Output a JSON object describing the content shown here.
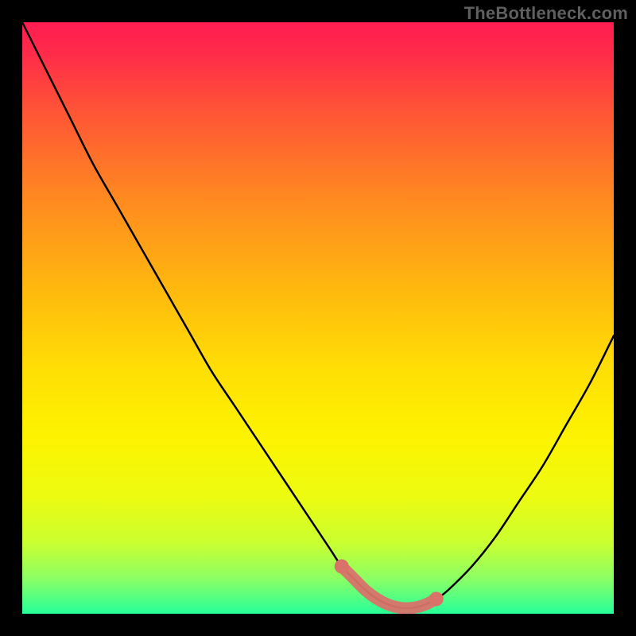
{
  "watermark": "TheBottleneck.com",
  "chart_data": {
    "type": "line",
    "title": "",
    "xlabel": "",
    "ylabel": "",
    "xlim": [
      0,
      100
    ],
    "ylim": [
      0,
      100
    ],
    "grid": false,
    "legend": false,
    "series": [
      {
        "name": "curve",
        "color": "#000000",
        "x": [
          0,
          4,
          8,
          12,
          16,
          20,
          24,
          28,
          32,
          36,
          40,
          44,
          48,
          52,
          54,
          56,
          58,
          60,
          62,
          64,
          66,
          68,
          70,
          72,
          76,
          80,
          84,
          88,
          92,
          96,
          100
        ],
        "y": [
          100,
          92,
          84,
          76,
          69,
          62,
          55,
          48,
          41,
          35,
          29,
          23,
          17,
          11,
          8,
          6,
          4,
          2.5,
          1.5,
          1,
          1,
          1.5,
          2.5,
          4,
          8,
          13,
          19,
          25,
          32,
          39,
          47
        ]
      }
    ],
    "highlight": {
      "name": "optimal-zone",
      "color": "#d9736a",
      "x_range": [
        54,
        70
      ],
      "y_at_x": [
        8,
        6,
        4,
        2.5,
        1.5,
        1,
        1,
        1.5,
        2.5
      ]
    },
    "background_gradient": {
      "stops": [
        {
          "offset": 0.0,
          "color": "#ff1d52"
        },
        {
          "offset": 0.05,
          "color": "#ff2a4a"
        },
        {
          "offset": 0.15,
          "color": "#ff5436"
        },
        {
          "offset": 0.3,
          "color": "#ff8a20"
        },
        {
          "offset": 0.45,
          "color": "#ffb80e"
        },
        {
          "offset": 0.58,
          "color": "#ffdd05"
        },
        {
          "offset": 0.7,
          "color": "#fdf300"
        },
        {
          "offset": 0.8,
          "color": "#edfb10"
        },
        {
          "offset": 0.88,
          "color": "#caff30"
        },
        {
          "offset": 0.94,
          "color": "#8cff64"
        },
        {
          "offset": 1.0,
          "color": "#27ff9a"
        }
      ]
    }
  }
}
